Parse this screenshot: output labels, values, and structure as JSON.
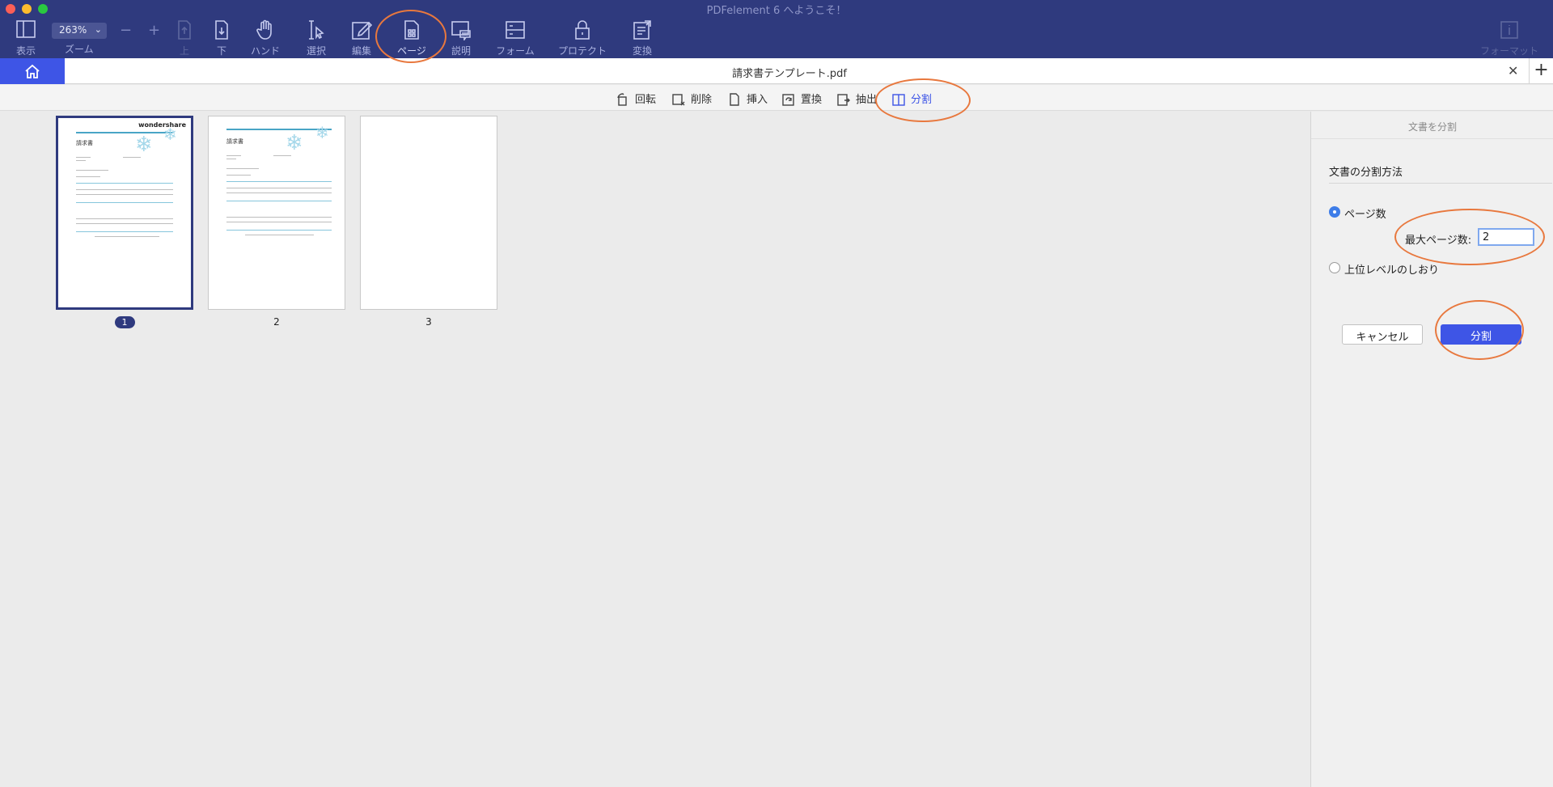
{
  "window": {
    "title": "PDFelement 6 へようこそ！"
  },
  "toolbar": {
    "view_label": "表示",
    "zoom_value": "263%",
    "zoom_label": "ズーム",
    "minus": "−",
    "plus": "+",
    "up_label": "上",
    "down_label": "下",
    "hand_label": "ハンド",
    "select_label": "選択",
    "edit_label": "編集",
    "page_label": "ページ",
    "comment_label": "説明",
    "form_label": "フォーム",
    "protect_label": "プロテクト",
    "convert_label": "変換",
    "format_label": "フォーマット"
  },
  "tabs": {
    "doc_title": "請求書テンプレート.pdf",
    "close": "✕",
    "add": "+"
  },
  "page_tools": {
    "rotate": "回転",
    "delete": "削除",
    "insert": "挿入",
    "replace": "置換",
    "extract": "抽出",
    "split": "分割"
  },
  "thumbnails": {
    "logo": "wondershare",
    "doc_heading": "請求書",
    "pages": [
      "1",
      "2",
      "3"
    ],
    "selected": "1"
  },
  "split_panel": {
    "header": "文書を分割",
    "section_title": "文書の分割方法",
    "option_pages": "ページ数",
    "max_pages_label": "最大ページ数:",
    "max_pages_value": "2",
    "option_bookmarks": "上位レベルのしおり",
    "cancel_button": "キャンセル",
    "split_button": "分割"
  },
  "colors": {
    "toolbar": "#2f3a7e",
    "accent": "#3e55e6",
    "annotation": "#e8783e"
  }
}
